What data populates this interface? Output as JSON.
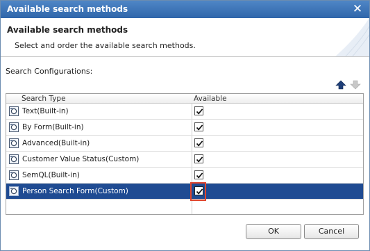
{
  "window": {
    "title": "Available search methods"
  },
  "banner": {
    "heading": "Available search methods",
    "description": "Select and order the available search methods."
  },
  "section_label": "Search Configurations:",
  "grid": {
    "columns": [
      "Search Type",
      "Available"
    ],
    "rows": [
      {
        "name": "Text(Built-in)",
        "available": true,
        "selected": false
      },
      {
        "name": "By Form(Built-in)",
        "available": true,
        "selected": false
      },
      {
        "name": "Advanced(Built-in)",
        "available": true,
        "selected": false
      },
      {
        "name": "Customer Value Status(Custom)",
        "available": true,
        "selected": false
      },
      {
        "name": "SemQL(Built-in)",
        "available": true,
        "selected": false
      },
      {
        "name": "Person Search Form(Custom)",
        "available": true,
        "selected": true
      }
    ]
  },
  "buttons": {
    "ok": "OK",
    "cancel": "Cancel"
  },
  "icons": {
    "close": "close-icon",
    "move_up": "arrow-up-icon",
    "move_down": "arrow-down-icon",
    "row": "search-method-icon"
  },
  "colors": {
    "title_bar": "#2f66aa",
    "selected_row": "#1f4b92",
    "highlight": "#e0452d"
  }
}
